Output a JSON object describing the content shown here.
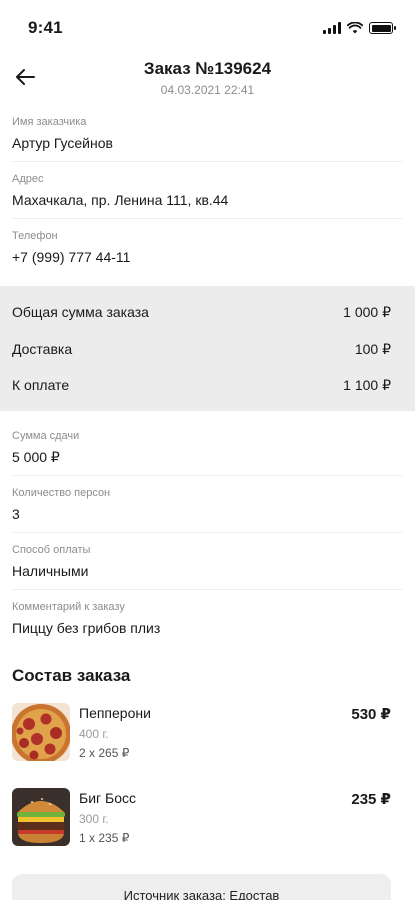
{
  "status_bar": {
    "time": "9:41"
  },
  "header": {
    "title": "Заказ №139624",
    "subtitle": "04.03.2021 22:41"
  },
  "customer": {
    "name_label": "Имя заказчика",
    "name_value": "Артур Гусейнов",
    "address_label": "Адрес",
    "address_value": "Махачкала, пр. Ленина 111, кв.44",
    "phone_label": "Телефон",
    "phone_value": "+7 (999) 777 44-11"
  },
  "summary": {
    "rows": [
      {
        "label": "Общая сумма заказа",
        "value": "1 000 ₽"
      },
      {
        "label": "Доставка",
        "value": "100 ₽"
      },
      {
        "label": "К оплате",
        "value": "1 100 ₽"
      }
    ]
  },
  "details": {
    "change_label": "Сумма сдачи",
    "change_value": "5 000 ₽",
    "persons_label": "Количество персон",
    "persons_value": "3",
    "payment_label": "Способ оплаты",
    "payment_value": "Наличными",
    "comment_label": "Комментарий к заказу",
    "comment_value": "Пиццу без грибов плиз"
  },
  "order": {
    "title": "Состав заказа",
    "items": [
      {
        "name": "Пепперони",
        "weight": "400 г.",
        "qty": "2 x 265 ₽",
        "price": "530 ₽",
        "icon": "pizza-image"
      },
      {
        "name": "Биг Босс",
        "weight": "300 г.",
        "qty": "1 x 235 ₽",
        "price": "235 ₽",
        "icon": "burger-image"
      }
    ]
  },
  "footer": {
    "source_text": "Источник заказа: Едостав"
  }
}
